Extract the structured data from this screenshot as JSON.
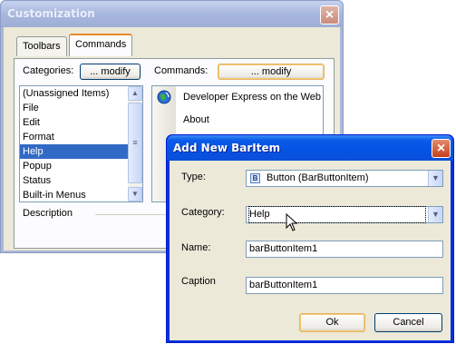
{
  "customization": {
    "title": "Customization",
    "tabs": [
      "Toolbars",
      "Commands"
    ],
    "categories_label": "Categories:",
    "categories_modify": "... modify",
    "commands_label": "Commands:",
    "commands_modify": "... modify",
    "categories": [
      "(Unassigned Items)",
      "File",
      "Edit",
      "Format",
      "Help",
      "Popup",
      "Status",
      "Built-in Menus"
    ],
    "selected_category": "Help",
    "commands": [
      "Developer Express on the Web",
      "About"
    ],
    "description_label": "Description"
  },
  "add_item": {
    "title": "Add New BarItem",
    "type_label": "Type:",
    "type_value": "Button (BarButtonItem)",
    "category_label": "Category:",
    "category_value": "Help",
    "name_label": "Name:",
    "name_value": "barButtonItem1",
    "caption_label": "Caption",
    "caption_value": "barButtonItem1",
    "ok_label": "Ok",
    "cancel_label": "Cancel"
  },
  "colors": {
    "active_title": "#0553e3",
    "inactive_title": "#a8b7dd",
    "selection": "#316ac5",
    "dialog_face": "#ece9d8"
  }
}
